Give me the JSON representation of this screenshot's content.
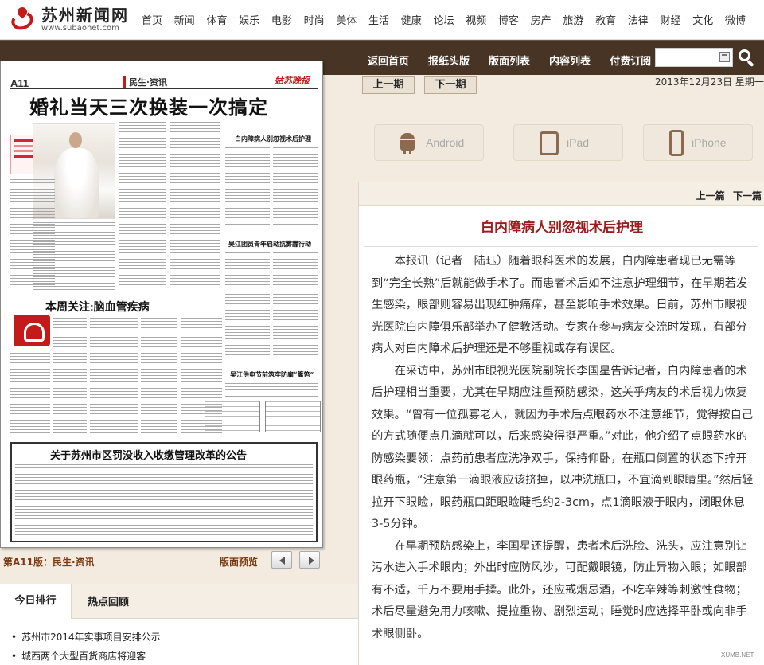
{
  "site": {
    "name": "苏州新闻网",
    "url": "www.subaonet.com"
  },
  "nav": [
    "首页",
    "新闻",
    "体育",
    "娱乐",
    "电影",
    "时尚",
    "美体",
    "生活",
    "健康",
    "论坛",
    "视频",
    "博客",
    "房产",
    "旅游",
    "教育",
    "法律",
    "财经",
    "文化",
    "微博"
  ],
  "toolbar": {
    "links": [
      "返回首页",
      "报纸头版",
      "版面列表",
      "内容列表",
      "付费订阅"
    ],
    "search_value": ""
  },
  "issue": {
    "prev_label": "上一期",
    "next_label": "下一期",
    "date": "2013年12月23日  星期一"
  },
  "devices": {
    "android": "Android",
    "ipad": "iPad",
    "iphone": "iPhone"
  },
  "paper": {
    "page_no": "A11",
    "section": "民生·资讯",
    "headline": "婚礼当天三次换装一次搞定",
    "sub1": "白内障病人别忽视术后护理",
    "sub2": "吴江团员青年启动抗雾霾行动",
    "sub3": "吴江供电节前筑牢防腐“篱笆”",
    "focus": "本周关注:脑血管疾病",
    "notice": "关于苏州市区罚没收入收缴管理改革的公告"
  },
  "page_caption": "第A11版：民生·资讯",
  "layout_preview": "版面预览",
  "rank": {
    "tab1": "今日排行",
    "tab2": "热点回顾",
    "items": [
      "苏州市2014年实事项目安排公示",
      "城西两个大型百货商店将迎客"
    ]
  },
  "article": {
    "prev": "上一篇",
    "next": "下一篇",
    "title": "白内障病人别忽视术后护理",
    "paragraphs": [
      "本报讯（记者　陆珏）随着眼科医术的发展，白内障患者现已无需等到“完全长熟”后就能做手术了。而患者术后如不注意护理细节，在早期若发生感染，眼部则容易出现红肿痛痒，甚至影响手术效果。日前，苏州市眼视光医院白内障俱乐部举办了健教活动。专家在参与病友交流时发现，有部分病人对白内障术后护理还是不够重视或存有误区。",
      "在采访中，苏州市眼视光医院副院长李国星告诉记者，白内障患者的术后护理相当重要，尤其在早期应注重预防感染，这关乎病友的术后视力恢复效果。“曾有一位孤寡老人，就因为手术后点眼药水不注意细节，觉得按自己的方式随便点几滴就可以，后来感染得挺严重。”对此，他介绍了点眼药水的防感染要领：点药前患者应洗净双手，保持仰卧，在瓶口倒置的状态下拧开眼药瓶，“注意第一滴眼液应该挤掉，以冲洗瓶口，不宜滴到眼睛里。”然后轻拉开下眼睑，眼药瓶口距眼睑睫毛约2-3cm，点1滴眼液于眼内，闭眼休息3-5分钟。",
      "在早期预防感染上，李国星还提醒，患者术后洗脸、洗头，应注意别让污水进入手术眼内；外出时应防风沙，可配戴眼镜，防止异物入眼；如眼部有不适，千万不要用手揉。此外，还应戒烟忌酒，不吃辛辣等刺激性食物；术后尽量避免用力咳嗽、提拉重物、剧烈运动；睡觉时应选择平卧或向非手术眼侧卧。"
    ]
  },
  "watermark": "XUMB.NET"
}
